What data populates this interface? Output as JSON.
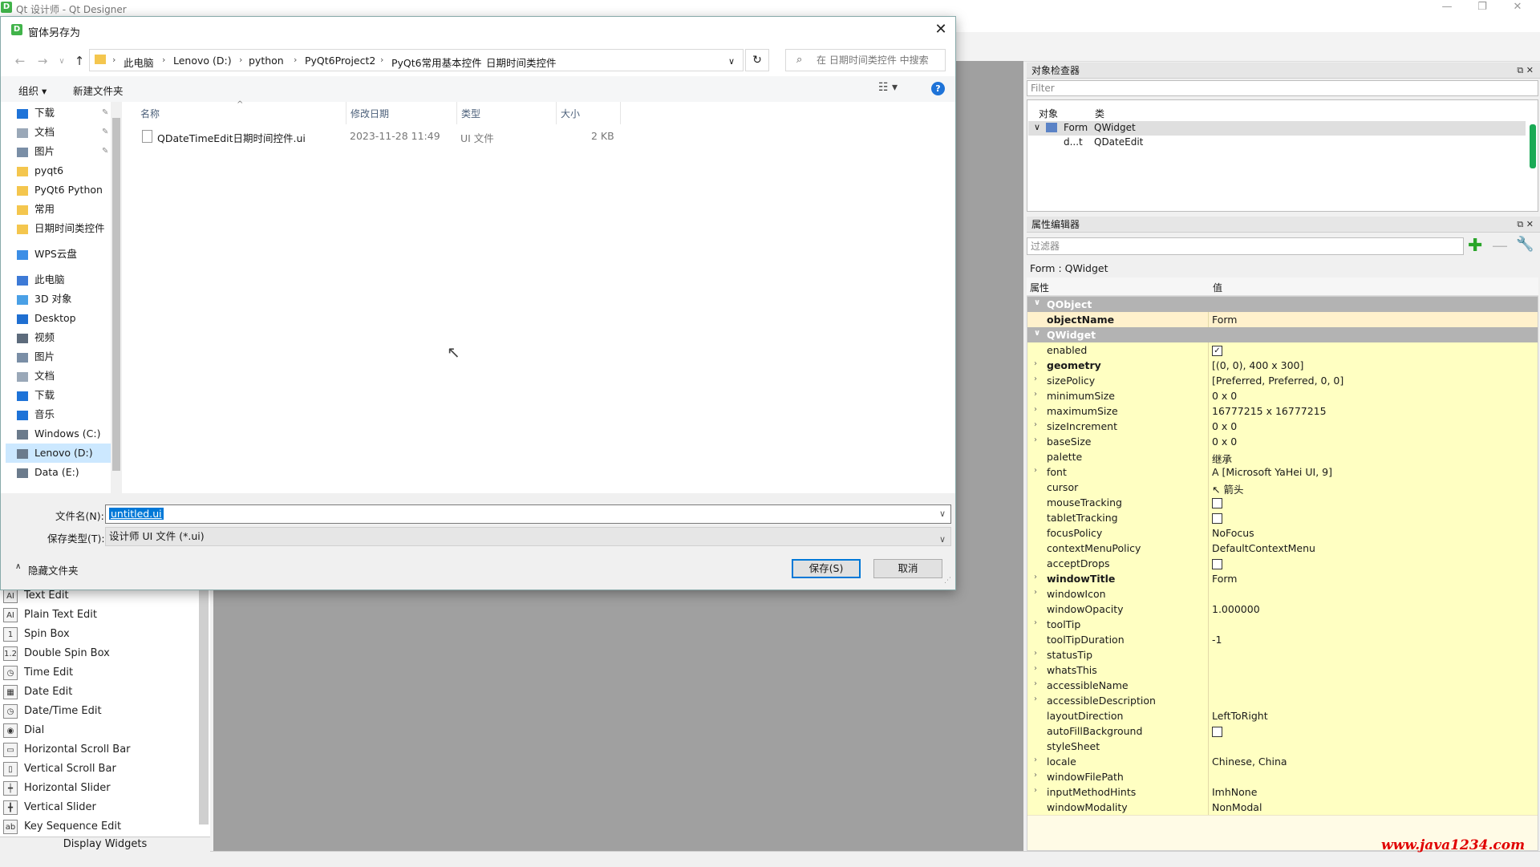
{
  "app": {
    "title": "Qt 设计师 - Qt Designer",
    "window_controls": [
      "—",
      "❐",
      "✕"
    ]
  },
  "widget_box": {
    "items": [
      {
        "label": "Text Edit",
        "icon": "text-edit-icon",
        "glyph": "AI"
      },
      {
        "label": "Plain Text Edit",
        "icon": "plain-text-edit-icon",
        "glyph": "AI"
      },
      {
        "label": "Spin Box",
        "icon": "spin-box-icon",
        "glyph": "1"
      },
      {
        "label": "Double Spin Box",
        "icon": "double-spin-box-icon",
        "glyph": "1.2"
      },
      {
        "label": "Time Edit",
        "icon": "clock-icon",
        "glyph": "◷"
      },
      {
        "label": "Date Edit",
        "icon": "calendar-icon",
        "glyph": "▦"
      },
      {
        "label": "Date/Time Edit",
        "icon": "datetime-icon",
        "glyph": "◷"
      },
      {
        "label": "Dial",
        "icon": "dial-icon",
        "glyph": "◉"
      },
      {
        "label": "Horizontal Scroll Bar",
        "icon": "hscrollbar-icon",
        "glyph": "▭"
      },
      {
        "label": "Vertical Scroll Bar",
        "icon": "vscrollbar-icon",
        "glyph": "▯"
      },
      {
        "label": "Horizontal Slider",
        "icon": "hslider-icon",
        "glyph": "┿"
      },
      {
        "label": "Vertical Slider",
        "icon": "vslider-icon",
        "glyph": "╋"
      },
      {
        "label": "Key Sequence Edit",
        "icon": "key-sequence-icon",
        "glyph": "ab"
      }
    ],
    "footer": "Display Widgets"
  },
  "object_inspector": {
    "title": "对象检查器",
    "filter_placeholder": "Filter",
    "col_object": "对象",
    "col_class": "类",
    "rows": [
      {
        "object": "Form",
        "class": "QWidget"
      },
      {
        "object": "d...t",
        "class": "QDateEdit"
      }
    ]
  },
  "property_editor": {
    "title": "属性编辑器",
    "filter_placeholder": "过滤器",
    "context": "Form : QWidget",
    "col_property": "属性",
    "col_value": "值",
    "rows": [
      {
        "name": "QObject",
        "value": "",
        "kind": "section"
      },
      {
        "name": "objectName",
        "value": "Form",
        "kind": "hl",
        "bold": true
      },
      {
        "name": "QWidget",
        "value": "",
        "kind": "section"
      },
      {
        "name": "enabled",
        "value": "",
        "kind": "y",
        "check": "✓"
      },
      {
        "name": "geometry",
        "value": "[(0, 0), 400 x 300]",
        "kind": "y",
        "bold": true,
        "arrow": true
      },
      {
        "name": "sizePolicy",
        "value": "[Preferred, Preferred, 0, 0]",
        "kind": "y",
        "arrow": true
      },
      {
        "name": "minimumSize",
        "value": "0 x 0",
        "kind": "y",
        "arrow": true
      },
      {
        "name": "maximumSize",
        "value": "16777215 x 16777215",
        "kind": "y",
        "arrow": true
      },
      {
        "name": "sizeIncrement",
        "value": "0 x 0",
        "kind": "y",
        "arrow": true
      },
      {
        "name": "baseSize",
        "value": "0 x 0",
        "kind": "y",
        "arrow": true
      },
      {
        "name": "palette",
        "value": "继承",
        "kind": "y"
      },
      {
        "name": "font",
        "value": "A  [Microsoft YaHei UI, 9]",
        "kind": "y",
        "arrow": true
      },
      {
        "name": "cursor",
        "value": "↖  箭头",
        "kind": "y"
      },
      {
        "name": "mouseTracking",
        "value": "",
        "kind": "y",
        "check": " "
      },
      {
        "name": "tabletTracking",
        "value": "",
        "kind": "y",
        "check": " "
      },
      {
        "name": "focusPolicy",
        "value": "NoFocus",
        "kind": "y"
      },
      {
        "name": "contextMenuPolicy",
        "value": "DefaultContextMenu",
        "kind": "y"
      },
      {
        "name": "acceptDrops",
        "value": "",
        "kind": "y",
        "check": " "
      },
      {
        "name": "windowTitle",
        "value": "Form",
        "kind": "y",
        "bold": true,
        "arrow": true
      },
      {
        "name": "windowIcon",
        "value": "",
        "kind": "y",
        "arrow": true
      },
      {
        "name": "windowOpacity",
        "value": "1.000000",
        "kind": "y"
      },
      {
        "name": "toolTip",
        "value": "",
        "kind": "y",
        "arrow": true
      },
      {
        "name": "toolTipDuration",
        "value": "-1",
        "kind": "y"
      },
      {
        "name": "statusTip",
        "value": "",
        "kind": "y",
        "arrow": true
      },
      {
        "name": "whatsThis",
        "value": "",
        "kind": "y",
        "arrow": true
      },
      {
        "name": "accessibleName",
        "value": "",
        "kind": "y",
        "arrow": true
      },
      {
        "name": "accessibleDescription",
        "value": "",
        "kind": "y",
        "arrow": true
      },
      {
        "name": "layoutDirection",
        "value": "LeftToRight",
        "kind": "y"
      },
      {
        "name": "autoFillBackground",
        "value": "",
        "kind": "y",
        "check": " "
      },
      {
        "name": "styleSheet",
        "value": "",
        "kind": "y"
      },
      {
        "name": "locale",
        "value": "Chinese, China",
        "kind": "y",
        "arrow": true
      },
      {
        "name": "windowFilePath",
        "value": "",
        "kind": "y",
        "arrow": true
      },
      {
        "name": "inputMethodHints",
        "value": "ImhNone",
        "kind": "y",
        "arrow": true
      },
      {
        "name": "windowModality",
        "value": "NonModal",
        "kind": "y"
      }
    ]
  },
  "dialog": {
    "title": "窗体另存为",
    "close": "✕",
    "breadcrumbs": [
      "此电脑",
      "Lenovo (D:)",
      "python",
      "PyQt6Project2",
      "PyQt6常用基本控件",
      "日期时间类控件"
    ],
    "search_placeholder": "在 日期时间类控件 中搜索",
    "organize": "组织 ▾",
    "new_folder": "新建文件夹",
    "help": "?",
    "nav_items": [
      {
        "label": "下载",
        "icon": "download-icon",
        "color": "#1e73d8",
        "pin": true
      },
      {
        "label": "文档",
        "icon": "document-icon",
        "color": "#9aa8b8",
        "pin": true
      },
      {
        "label": "图片",
        "icon": "picture-icon",
        "color": "#7a8ea6",
        "pin": true
      },
      {
        "label": "pyqt6",
        "icon": "folder-icon",
        "color": "#f4c64e"
      },
      {
        "label": "PyQt6 Python",
        "icon": "folder-icon",
        "color": "#f4c64e"
      },
      {
        "label": "常用",
        "icon": "folder-icon",
        "color": "#f4c64e"
      },
      {
        "label": "日期时间类控件",
        "icon": "folder-icon",
        "color": "#f4c64e"
      },
      {
        "label": "WPS云盘",
        "icon": "cloud-icon",
        "color": "#3c8ee6",
        "gap": true
      },
      {
        "label": "此电脑",
        "icon": "computer-icon",
        "color": "#3d7ad6",
        "gap": true
      },
      {
        "label": "3D 对象",
        "icon": "cube-icon",
        "color": "#4aa0e6"
      },
      {
        "label": "Desktop",
        "icon": "desktop-icon",
        "color": "#1f6fd1"
      },
      {
        "label": "视频",
        "icon": "video-icon",
        "color": "#5d6b7c"
      },
      {
        "label": "图片",
        "icon": "picture-icon",
        "color": "#7a8ea6"
      },
      {
        "label": "文档",
        "icon": "document-icon",
        "color": "#9aa8b8"
      },
      {
        "label": "下载",
        "icon": "download-icon",
        "color": "#1e73d8"
      },
      {
        "label": "音乐",
        "icon": "music-icon",
        "color": "#1e73d8"
      },
      {
        "label": "Windows (C:)",
        "icon": "drive-icon",
        "color": "#6b7b8c"
      },
      {
        "label": "Lenovo (D:)",
        "icon": "drive-icon",
        "color": "#6b7b8c",
        "selected": true
      },
      {
        "label": "Data (E:)",
        "icon": "drive-icon",
        "color": "#6b7b8c"
      }
    ],
    "columns": [
      "名称",
      "修改日期",
      "类型",
      "大小"
    ],
    "files": [
      {
        "name": "QDateTimeEdit日期时间控件.ui",
        "date": "2023-11-28 11:49",
        "type": "UI 文件",
        "size": "2 KB"
      }
    ],
    "filename_label": "文件名(N):",
    "filename_value": "untitled.ui",
    "filetype_label": "保存类型(T):",
    "filetype_value": "设计师 UI 文件 (*.ui)",
    "hide_folders": "隐藏文件夹",
    "save_button": "保存(S)",
    "cancel_button": "取消"
  },
  "watermark": "www.java1234.com"
}
